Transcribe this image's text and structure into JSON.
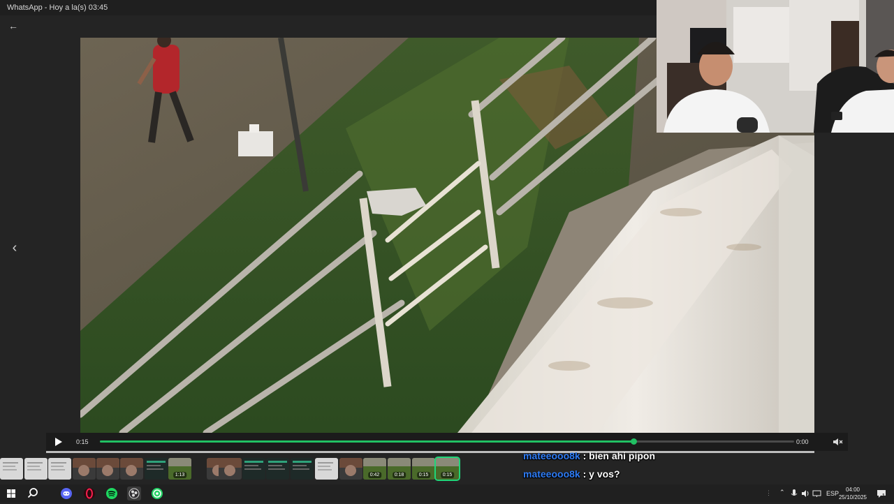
{
  "window": {
    "title": "WhatsApp - Hoy a la(s) 03:45"
  },
  "nav": {
    "back_icon": "arrow-left-icon",
    "prev_icon": "chevron-left-icon"
  },
  "player": {
    "current_time": "0:15",
    "total_time": "0:00",
    "progress_fraction": 0.769,
    "accent_color": "#21c063",
    "play_icon": "play-icon",
    "mute_icon": "volume-muted-icon"
  },
  "thumbnails": [
    {
      "kind": "document"
    },
    {
      "kind": "document"
    },
    {
      "kind": "document"
    },
    {
      "kind": "photo"
    },
    {
      "kind": "photo"
    },
    {
      "kind": "photo"
    },
    {
      "kind": "screenshot"
    },
    {
      "kind": "video",
      "duration": "1:13"
    },
    {
      "kind": "photo"
    },
    {
      "kind": "photo"
    },
    {
      "kind": "screenshot"
    },
    {
      "kind": "screenshot"
    },
    {
      "kind": "screenshot"
    },
    {
      "kind": "document"
    },
    {
      "kind": "photo"
    },
    {
      "kind": "video",
      "duration": "0:42"
    },
    {
      "kind": "video",
      "duration": "0:18"
    },
    {
      "kind": "video",
      "duration": "0:15"
    },
    {
      "kind": "video",
      "duration": "0:15",
      "selected": true
    }
  ],
  "chat": [
    {
      "user": "mateeooo8k",
      "message": " : bien ahi pipon"
    },
    {
      "user": "mateeooo8k",
      "message": " : y vos?"
    }
  ],
  "taskbar": {
    "apps": [
      "windows-start-icon",
      "search-icon",
      "discord-icon",
      "opera-gx-icon",
      "spotify-icon",
      "obs-icon",
      "whatsapp-icon"
    ],
    "language": "ESP",
    "time": "04:00",
    "date": "25/10/2025",
    "notification_count": "1"
  }
}
